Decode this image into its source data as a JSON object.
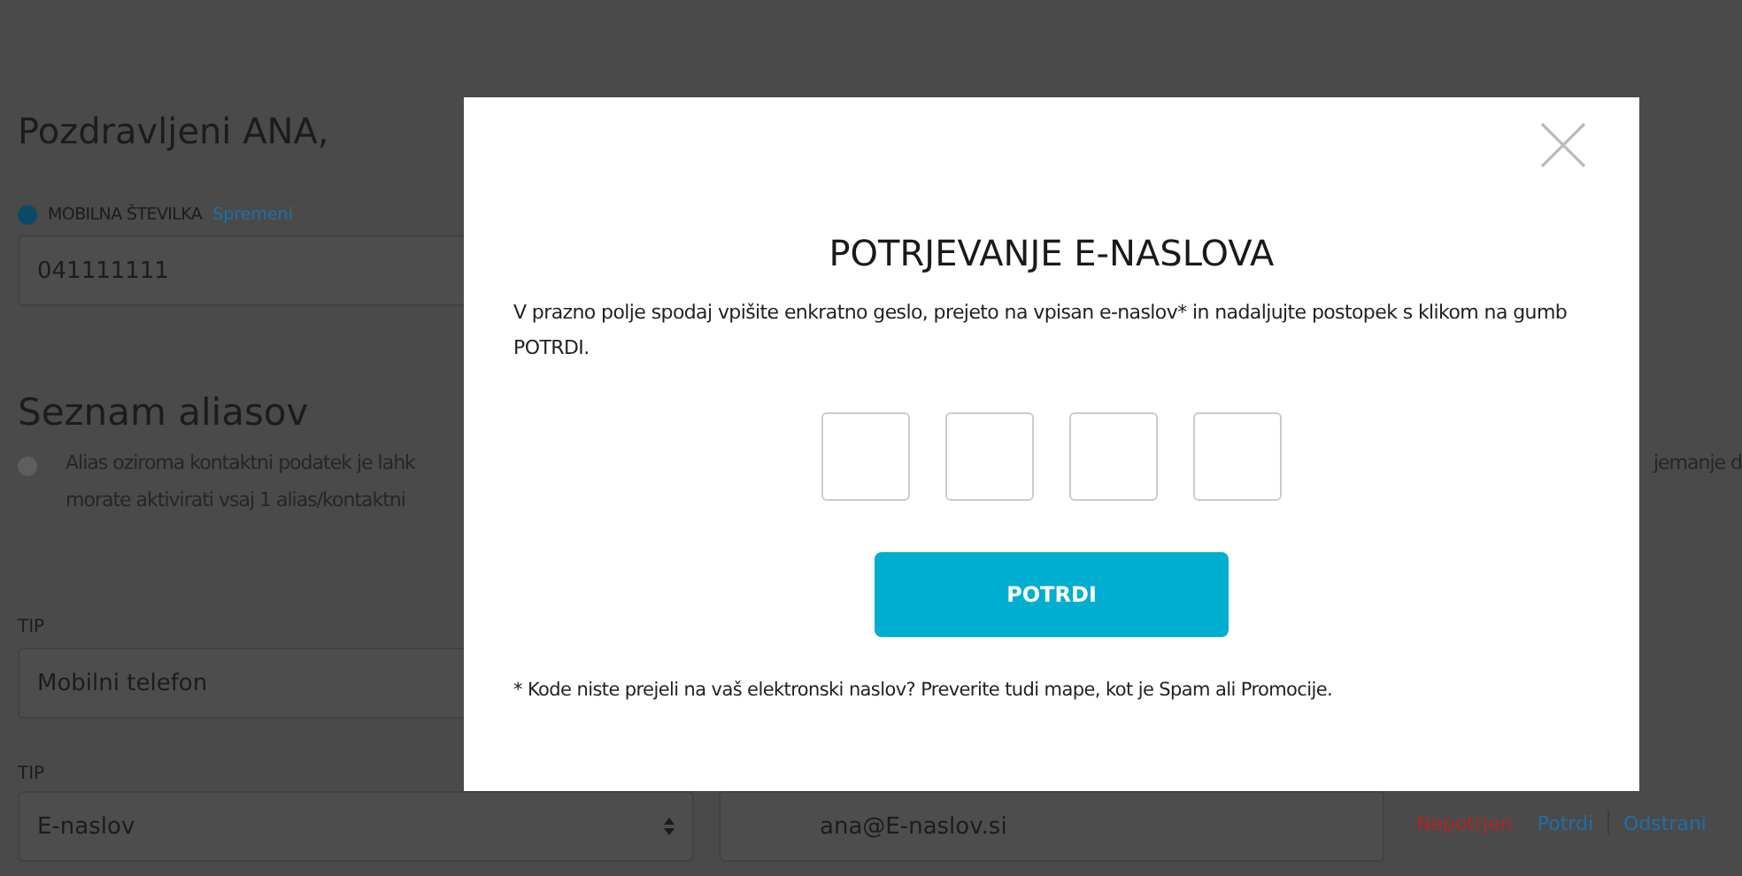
{
  "page": {
    "greeting": "Pozdravljeni  ANA,",
    "mobile": {
      "label": "MOBILNA ŠTEVILKA",
      "link": "Spremeni",
      "value": "041111111"
    },
    "aliases": {
      "title": "Seznam aliasov",
      "info_lines": [
        "Alias oziroma kontaktni podatek je lahk",
        "morate aktivirati vsaj 1 alias/kontaktni"
      ],
      "info_right": "jemanje d",
      "rows": [
        {
          "type_label": "TIP",
          "type_value": "Mobilni telefon"
        },
        {
          "type_label": "TIP",
          "type_value": "E-naslov",
          "value": "ana@E-naslov.si",
          "status": "Nepotrjen",
          "actions": [
            "Potrdi",
            "Odstrani"
          ]
        }
      ]
    }
  },
  "modal": {
    "title": "POTRJEVANJE E-NASLOVA",
    "instructions": "V prazno polje spodaj vpišite enkratno geslo, prejeto na vpisan e-naslov* in nadaljujte postopek s klikom na gumb POTRDI.",
    "code_fields": [
      {
        "kind": "digit"
      },
      {
        "kind": "digit"
      },
      {
        "kind": "digit"
      },
      {
        "kind": "digit"
      }
    ],
    "button": "POTRDI",
    "footnote": "* Kode niste prejeli na vaš elektronski naslov? Preverite tudi mape, kot je Spam ali Promocije."
  }
}
